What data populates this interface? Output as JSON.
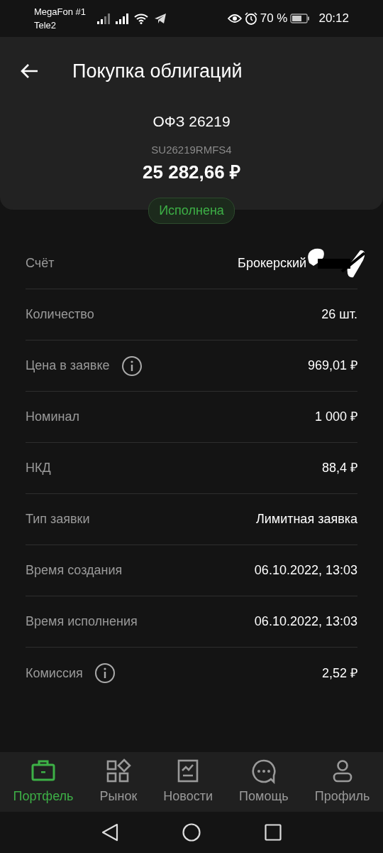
{
  "status_bar": {
    "carrier_1": "MegaFon #1",
    "carrier_2": "Tele2",
    "battery_text": "70 %",
    "time": "20:12"
  },
  "header": {
    "title": "Покупка облигаций"
  },
  "bond": {
    "name": "ОФЗ 26219",
    "isin": "SU26219RMFS4",
    "amount": "25 282,66 ₽",
    "status": "Исполнена"
  },
  "details": [
    {
      "label": "Счёт",
      "value": "Брокерский",
      "info": false,
      "redacted": true
    },
    {
      "label": "Количество",
      "value": "26 шт.",
      "info": false,
      "redacted": false
    },
    {
      "label": "Цена в заявке",
      "value": "969,01 ₽",
      "info": true,
      "redacted": false
    },
    {
      "label": "Номинал",
      "value": "1 000 ₽",
      "info": false,
      "redacted": false
    },
    {
      "label": "НКД",
      "value": "88,4 ₽",
      "info": false,
      "redacted": false
    },
    {
      "label": "Тип заявки",
      "value": "Лимитная заявка",
      "info": false,
      "redacted": false
    },
    {
      "label": "Время создания",
      "value": "06.10.2022, 13:03",
      "info": false,
      "redacted": false
    },
    {
      "label": "Время исполнения",
      "value": "06.10.2022, 13:03",
      "info": false,
      "redacted": false
    },
    {
      "label": "Комиссия",
      "value": "2,52 ₽",
      "info": true,
      "redacted": false
    }
  ],
  "bottom_nav": [
    {
      "label": "Портфель",
      "kind": "briefcase",
      "selected": true
    },
    {
      "label": "Рынок",
      "kind": "market",
      "selected": false
    },
    {
      "label": "Новости",
      "kind": "news",
      "selected": false
    },
    {
      "label": "Помощь",
      "kind": "help",
      "selected": false
    },
    {
      "label": "Профиль",
      "kind": "profile",
      "selected": false
    }
  ]
}
